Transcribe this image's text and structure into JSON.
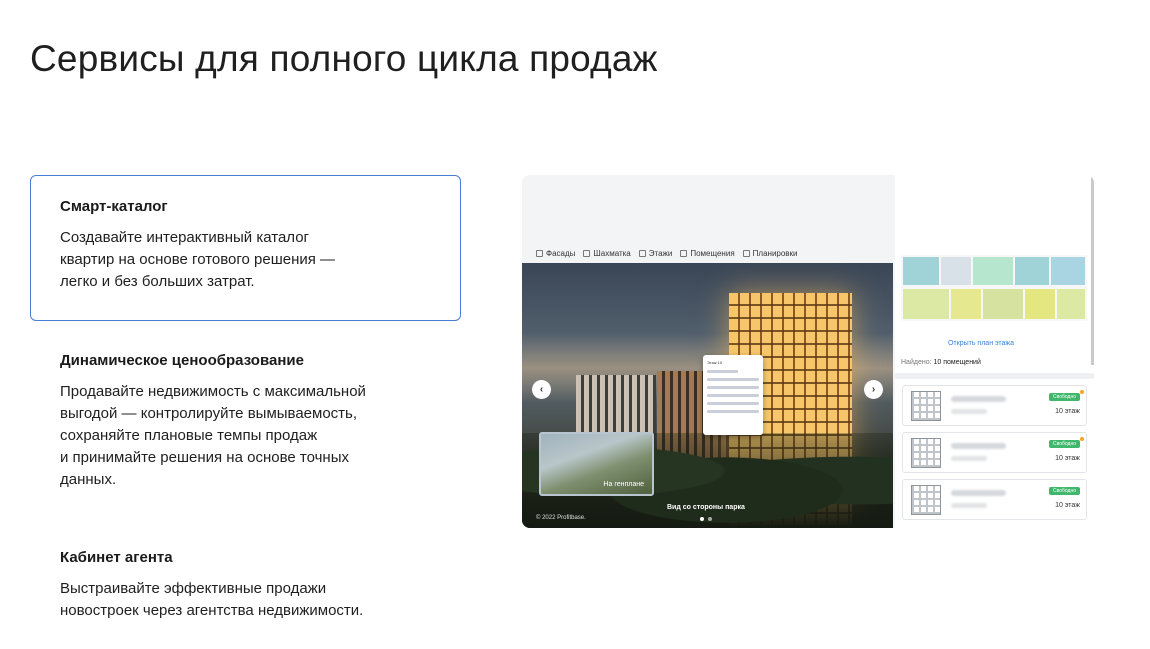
{
  "header": {
    "title": "Сервисы для полного цикла продаж"
  },
  "features": [
    {
      "title": "Смарт-каталог",
      "text": "Создавайте интерактивный каталог\nквартир на основе готового решения —\nлегко и без больших затрат."
    },
    {
      "title": "Динамическое ценообразование",
      "text": "Продавайте недвижимость с максимальной\nвыгодой — контролируйте вымываемость,\nсохраняйте плановые темпы продаж\nи принимайте решения на основе точных\nданных."
    },
    {
      "title": "Кабинет агента",
      "text": "Выстраивайте эффективные продажи\nновостроек через агентства недвижимости."
    }
  ],
  "preview": {
    "tabs": [
      "Фасады",
      "Шахматка",
      "Этажи",
      "Помещения",
      "Планировки"
    ],
    "popup_title": "Этаж 10",
    "thumb_label": "На генплане",
    "scene_caption": "Вид со стороны парка",
    "copyright": "© 2022 Profitbase.",
    "plan_link": "Открыть план этажа",
    "found_label": "Найдено:",
    "found_value": "10 помещений",
    "apartments": [
      {
        "status": "Свободно",
        "floor": "10 этаж"
      },
      {
        "status": "Свободно",
        "floor": "10 этаж"
      },
      {
        "status": "Свободно",
        "floor": "10 этаж"
      }
    ],
    "colors": {
      "accent": "#4a7bd9",
      "status_free": "#3fb86b",
      "link": "#3b82d6"
    }
  }
}
